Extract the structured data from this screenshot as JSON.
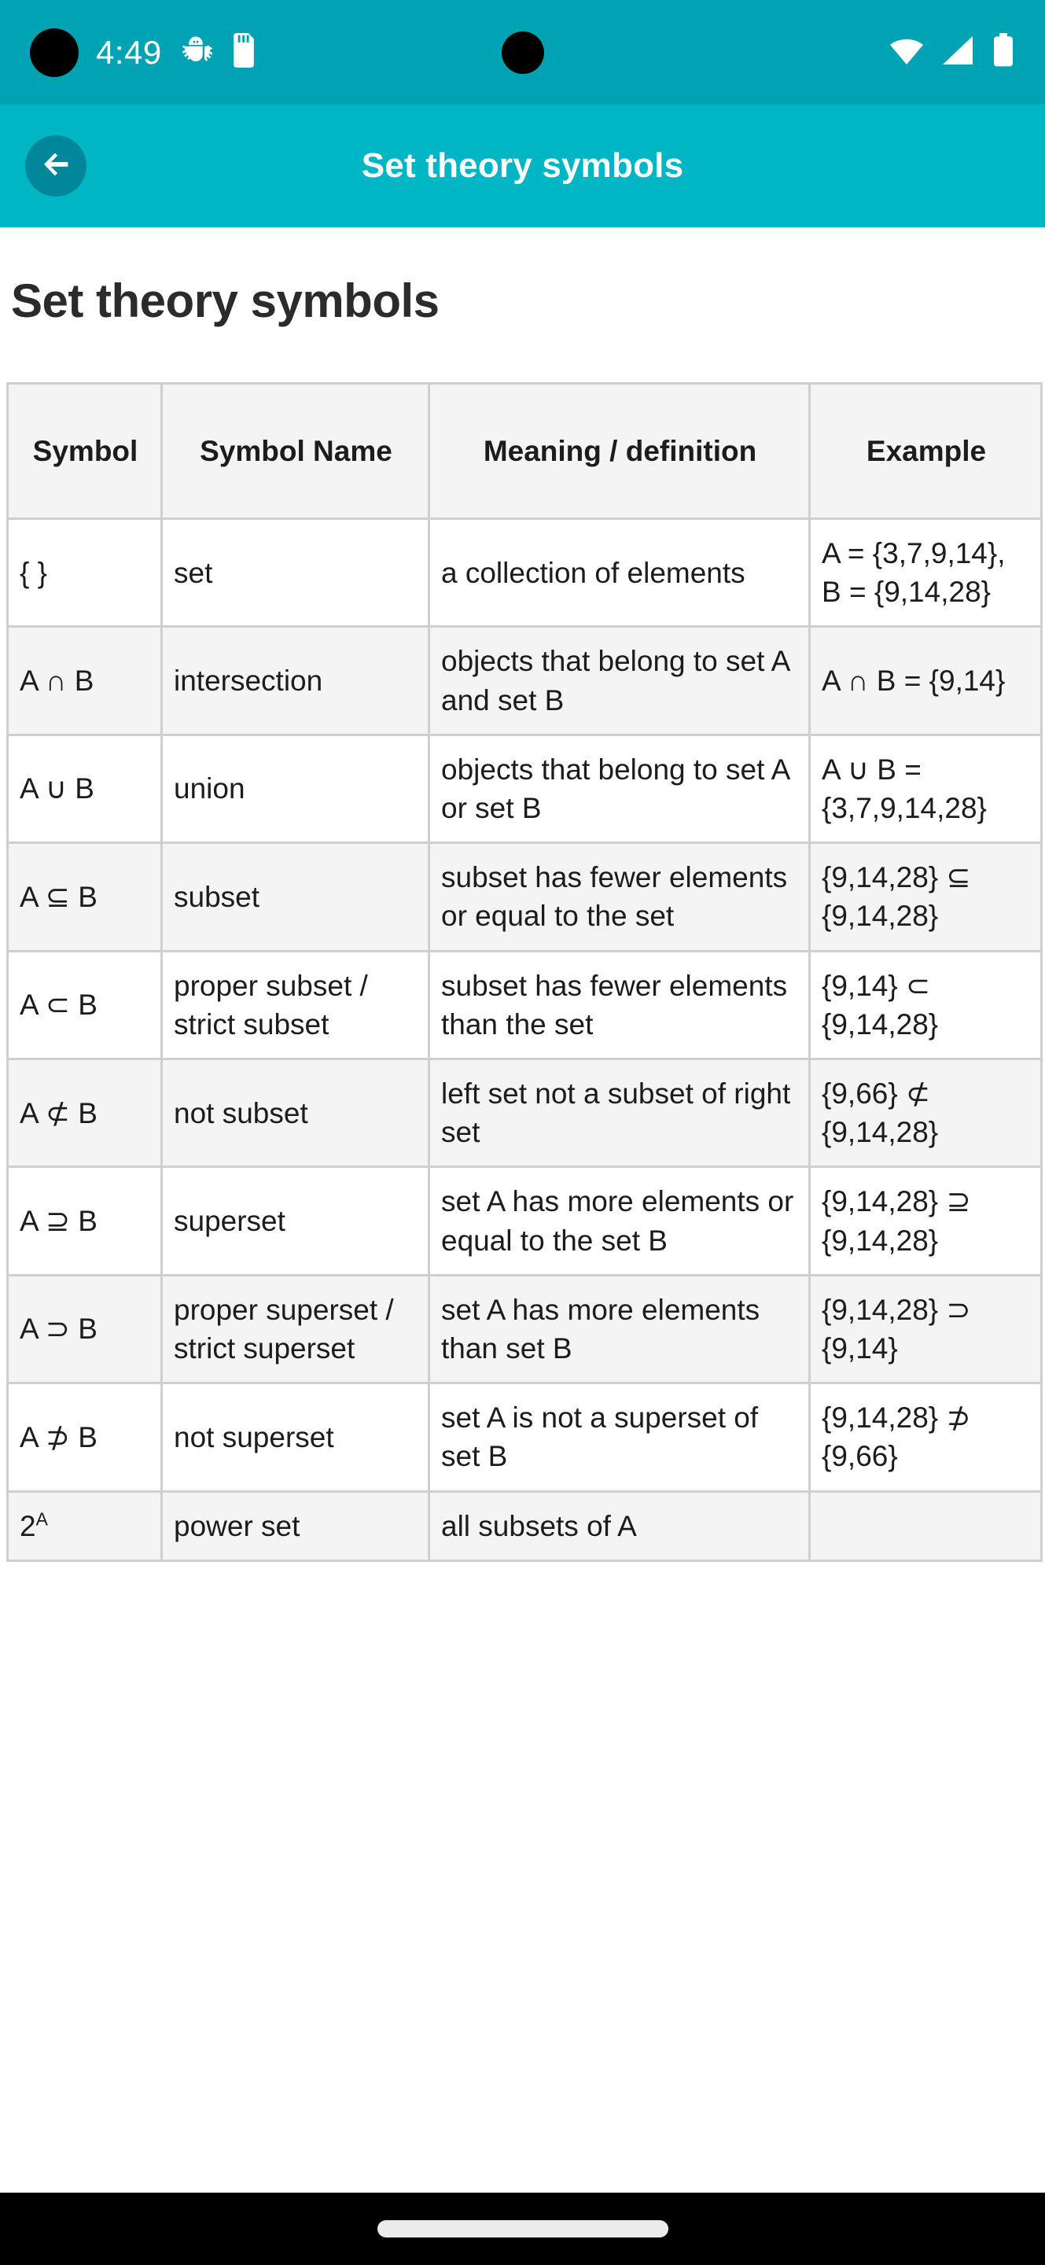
{
  "statusbar": {
    "time": "4:49",
    "icons": [
      "android-debug-icon",
      "sd-card-icon"
    ],
    "right_icons": [
      "wifi-icon",
      "cellular-signal-icon",
      "battery-icon"
    ]
  },
  "appbar": {
    "back_label": "back-arrow",
    "title": "Set theory symbols"
  },
  "page": {
    "title": "Set theory symbols"
  },
  "table": {
    "headers": [
      "Symbol",
      "Symbol Name",
      "Meaning / definition",
      "Example"
    ],
    "rows": [
      {
        "symbol": "{ }",
        "name": "set",
        "meaning": "a collection of elements",
        "example": "A = {3,7,9,14}, B = {9,14,28}"
      },
      {
        "symbol": "A ∩ B",
        "name": "intersection",
        "meaning": "objects that belong to set A and set B",
        "example": "A ∩ B = {9,14}"
      },
      {
        "symbol": "A ∪ B",
        "name": "union",
        "meaning": "objects that belong to set A or set B",
        "example": "A ∪ B = {3,7,9,14,28}"
      },
      {
        "symbol": "A ⊆ B",
        "name": "subset",
        "meaning": "subset has fewer elements or equal to the set",
        "example": "{9,14,28} ⊆ {9,14,28}"
      },
      {
        "symbol": "A ⊂ B",
        "name": "proper subset / strict subset",
        "meaning": "subset has fewer elements than the set",
        "example": "{9,14} ⊂ {9,14,28}"
      },
      {
        "symbol": "A ⊄ B",
        "name": "not subset",
        "meaning": "left set not a subset of right set",
        "example": "{9,66} ⊄ {9,14,28}"
      },
      {
        "symbol": "A ⊇ B",
        "name": "superset",
        "meaning": "set A has more elements or equal to the set B",
        "example": "{9,14,28} ⊇ {9,14,28}"
      },
      {
        "symbol": "A ⊃ B",
        "name": "proper superset / strict superset",
        "meaning": "set A has more elements than set B",
        "example": "{9,14,28} ⊃ {9,14}"
      },
      {
        "symbol": "A ⊅ B",
        "name": "not superset",
        "meaning": "set A is not a superset of set B",
        "example": "{9,14,28} ⊅ {9,66}"
      },
      {
        "symbol": "2^A",
        "symbol_base": "2",
        "symbol_sup": "A",
        "name": "power set",
        "meaning": "all subsets of A",
        "example": ""
      }
    ]
  },
  "navbar": {
    "home_indicator": "home-indicator"
  }
}
